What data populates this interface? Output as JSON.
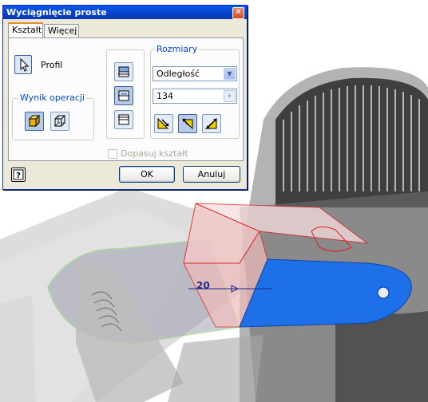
{
  "dialog": {
    "title": "Wyciągnięcie proste",
    "tabs": [
      {
        "label": "Kształt",
        "active": true
      },
      {
        "label": "Więcej",
        "active": false
      }
    ],
    "profile_label": "Profil",
    "operation_group": {
      "title": "Wynik operacji",
      "buttons": [
        {
          "icon": "solid-cube-icon",
          "pressed": true
        },
        {
          "icon": "surface-cube-icon",
          "pressed": false
        }
      ]
    },
    "direction_buttons": [
      {
        "icon": "direction-up-icon",
        "pressed": false
      },
      {
        "icon": "direction-middle-icon",
        "pressed": true
      },
      {
        "icon": "direction-down-icon",
        "pressed": false
      }
    ],
    "dimensions_group": {
      "title": "Rozmiary",
      "extent_select": "Odległość",
      "distance_value": "134",
      "buttons": [
        {
          "icon": "flip-direction-1-icon",
          "pressed": false
        },
        {
          "icon": "flip-direction-2-icon",
          "pressed": true
        },
        {
          "icon": "symmetric-direction-icon",
          "pressed": false
        }
      ]
    },
    "match_shape_label": "Dopasuj kształt",
    "match_shape_checked": false,
    "help_icon": "help-icon",
    "ok_label": "OK",
    "cancel_label": "Anuluj",
    "close_icon": "close-icon"
  },
  "viewport": {
    "dimension_label": "20",
    "colors": {
      "extrusion_face": "#1e70e8",
      "preview_edges": "#e02020",
      "profile_edges": "#66cc44"
    }
  }
}
